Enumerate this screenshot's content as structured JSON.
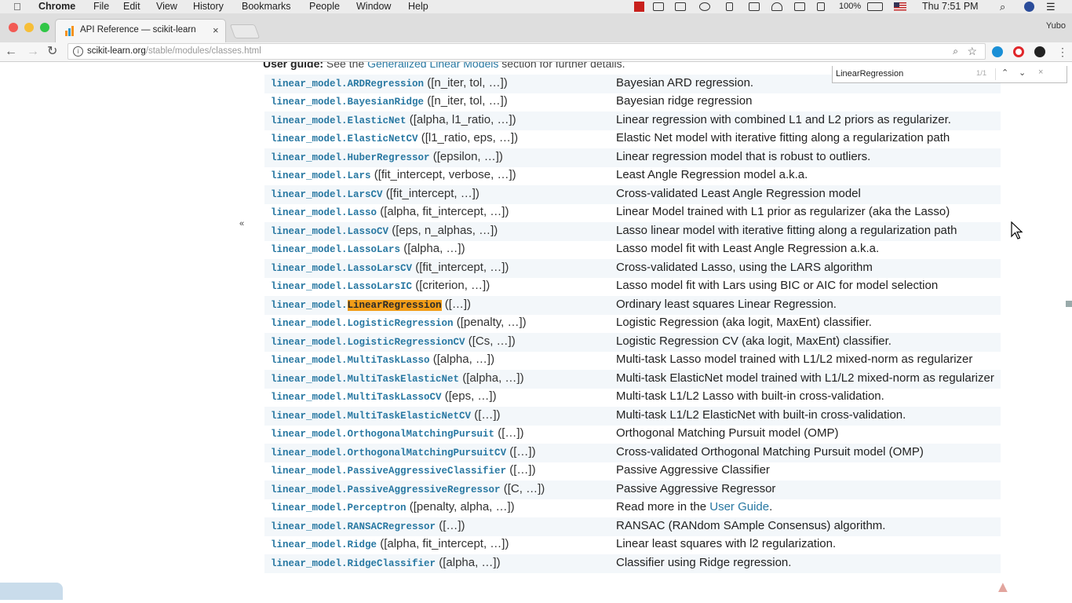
{
  "menubar": {
    "apple": "",
    "app": "Chrome",
    "items": [
      "File",
      "Edit",
      "View",
      "History",
      "Bookmarks",
      "People",
      "Window",
      "Help"
    ],
    "battery": "100%",
    "clock": "Thu 7:51 PM"
  },
  "tab": {
    "title": "API Reference — scikit-learn",
    "close": "×"
  },
  "profile": "Yubo",
  "toolbar": {
    "back": "←",
    "forward": "→",
    "reload": "↻",
    "url_host": "scikit-learn.org",
    "url_path": "/stable/modules/classes.html",
    "zoom_icon": "⌕",
    "star_icon": "☆"
  },
  "findbar": {
    "query": "LinearRegression",
    "count": "1/1",
    "up": "⌃",
    "down": "⌄",
    "close": "×"
  },
  "page": {
    "userguide_bold": "User guide:",
    "userguide_text": " See the ",
    "userguide_link": "Generalized Linear Models",
    "userguide_tail": " section for further details.",
    "collapse": "«"
  },
  "rows": [
    {
      "module": "linear_model.",
      "cls": "ARDRegression",
      "args": " ([n_iter, tol, …])",
      "desc": "Bayesian ARD regression."
    },
    {
      "module": "linear_model.",
      "cls": "BayesianRidge",
      "args": " ([n_iter, tol, …])",
      "desc": "Bayesian ridge regression"
    },
    {
      "module": "linear_model.",
      "cls": "ElasticNet",
      "args": " ([alpha, l1_ratio, …])",
      "desc": "Linear regression with combined L1 and L2 priors as regularizer."
    },
    {
      "module": "linear_model.",
      "cls": "ElasticNetCV",
      "args": " ([l1_ratio, eps, …])",
      "desc": "Elastic Net model with iterative fitting along a regularization path"
    },
    {
      "module": "linear_model.",
      "cls": "HuberRegressor",
      "args": " ([epsilon, …])",
      "desc": "Linear regression model that is robust to outliers."
    },
    {
      "module": "linear_model.",
      "cls": "Lars",
      "args": " ([fit_intercept, verbose, …])",
      "desc": "Least Angle Regression model a.k.a."
    },
    {
      "module": "linear_model.",
      "cls": "LarsCV",
      "args": " ([fit_intercept, …])",
      "desc": "Cross-validated Least Angle Regression model"
    },
    {
      "module": "linear_model.",
      "cls": "Lasso",
      "args": " ([alpha, fit_intercept, …])",
      "desc": "Linear Model trained with L1 prior as regularizer (aka the Lasso)"
    },
    {
      "module": "linear_model.",
      "cls": "LassoCV",
      "args": " ([eps, n_alphas, …])",
      "desc": "Lasso linear model with iterative fitting along a regularization path"
    },
    {
      "module": "linear_model.",
      "cls": "LassoLars",
      "args": " ([alpha, …])",
      "desc": "Lasso model fit with Least Angle Regression a.k.a."
    },
    {
      "module": "linear_model.",
      "cls": "LassoLarsCV",
      "args": " ([fit_intercept, …])",
      "desc": "Cross-validated Lasso, using the LARS algorithm"
    },
    {
      "module": "linear_model.",
      "cls": "LassoLarsIC",
      "args": " ([criterion, …])",
      "desc": "Lasso model fit with Lars using BIC or AIC for model selection"
    },
    {
      "module": "linear_model.",
      "cls": "LinearRegression",
      "args": " ([…])",
      "desc": "Ordinary least squares Linear Regression.",
      "highlight": true
    },
    {
      "module": "linear_model.",
      "cls": "LogisticRegression",
      "args": " ([penalty, …])",
      "desc": "Logistic Regression (aka logit, MaxEnt) classifier."
    },
    {
      "module": "linear_model.",
      "cls": "LogisticRegressionCV",
      "args": " ([Cs, …])",
      "desc": "Logistic Regression CV (aka logit, MaxEnt) classifier."
    },
    {
      "module": "linear_model.",
      "cls": "MultiTaskLasso",
      "args": " ([alpha, …])",
      "desc": "Multi-task Lasso model trained with L1/L2 mixed-norm as regularizer"
    },
    {
      "module": "linear_model.",
      "cls": "MultiTaskElasticNet",
      "args": " ([alpha, …])",
      "desc": "Multi-task ElasticNet model trained with L1/L2 mixed-norm as regularizer"
    },
    {
      "module": "linear_model.",
      "cls": "MultiTaskLassoCV",
      "args": " ([eps, …])",
      "desc": "Multi-task L1/L2 Lasso with built-in cross-validation."
    },
    {
      "module": "linear_model.",
      "cls": "MultiTaskElasticNetCV",
      "args": " ([…])",
      "desc": "Multi-task L1/L2 ElasticNet with built-in cross-validation."
    },
    {
      "module": "linear_model.",
      "cls": "OrthogonalMatchingPursuit",
      "args": " ([…])",
      "desc": "Orthogonal Matching Pursuit model (OMP)"
    },
    {
      "module": "linear_model.",
      "cls": "OrthogonalMatchingPursuitCV",
      "args": " ([…])",
      "desc": "Cross-validated Orthogonal Matching Pursuit model (OMP)"
    },
    {
      "module": "linear_model.",
      "cls": "PassiveAggressiveClassifier",
      "args": " ([…])",
      "desc": "Passive Aggressive Classifier"
    },
    {
      "module": "linear_model.",
      "cls": "PassiveAggressiveRegressor",
      "args": " ([C, …])",
      "desc": "Passive Aggressive Regressor"
    },
    {
      "module": "linear_model.",
      "cls": "Perceptron",
      "args": " ([penalty, alpha, …])",
      "desc": "Read more in the ",
      "desc_link": "User Guide",
      "desc_tail": "."
    },
    {
      "module": "linear_model.",
      "cls": "RANSACRegressor",
      "args": " ([…])",
      "desc": "RANSAC (RANdom SAmple Consensus) algorithm."
    },
    {
      "module": "linear_model.",
      "cls": "Ridge",
      "args": " ([alpha, fit_intercept, …])",
      "desc": "Linear least squares with l2 regularization."
    },
    {
      "module": "linear_model.",
      "cls": "RidgeClassifier",
      "args": " ([alpha, …])",
      "desc": "Classifier using Ridge regression."
    }
  ],
  "colors": {
    "link": "#2878a2",
    "highlight": "#f29d18",
    "row_stripe": "#f3f7fa"
  }
}
